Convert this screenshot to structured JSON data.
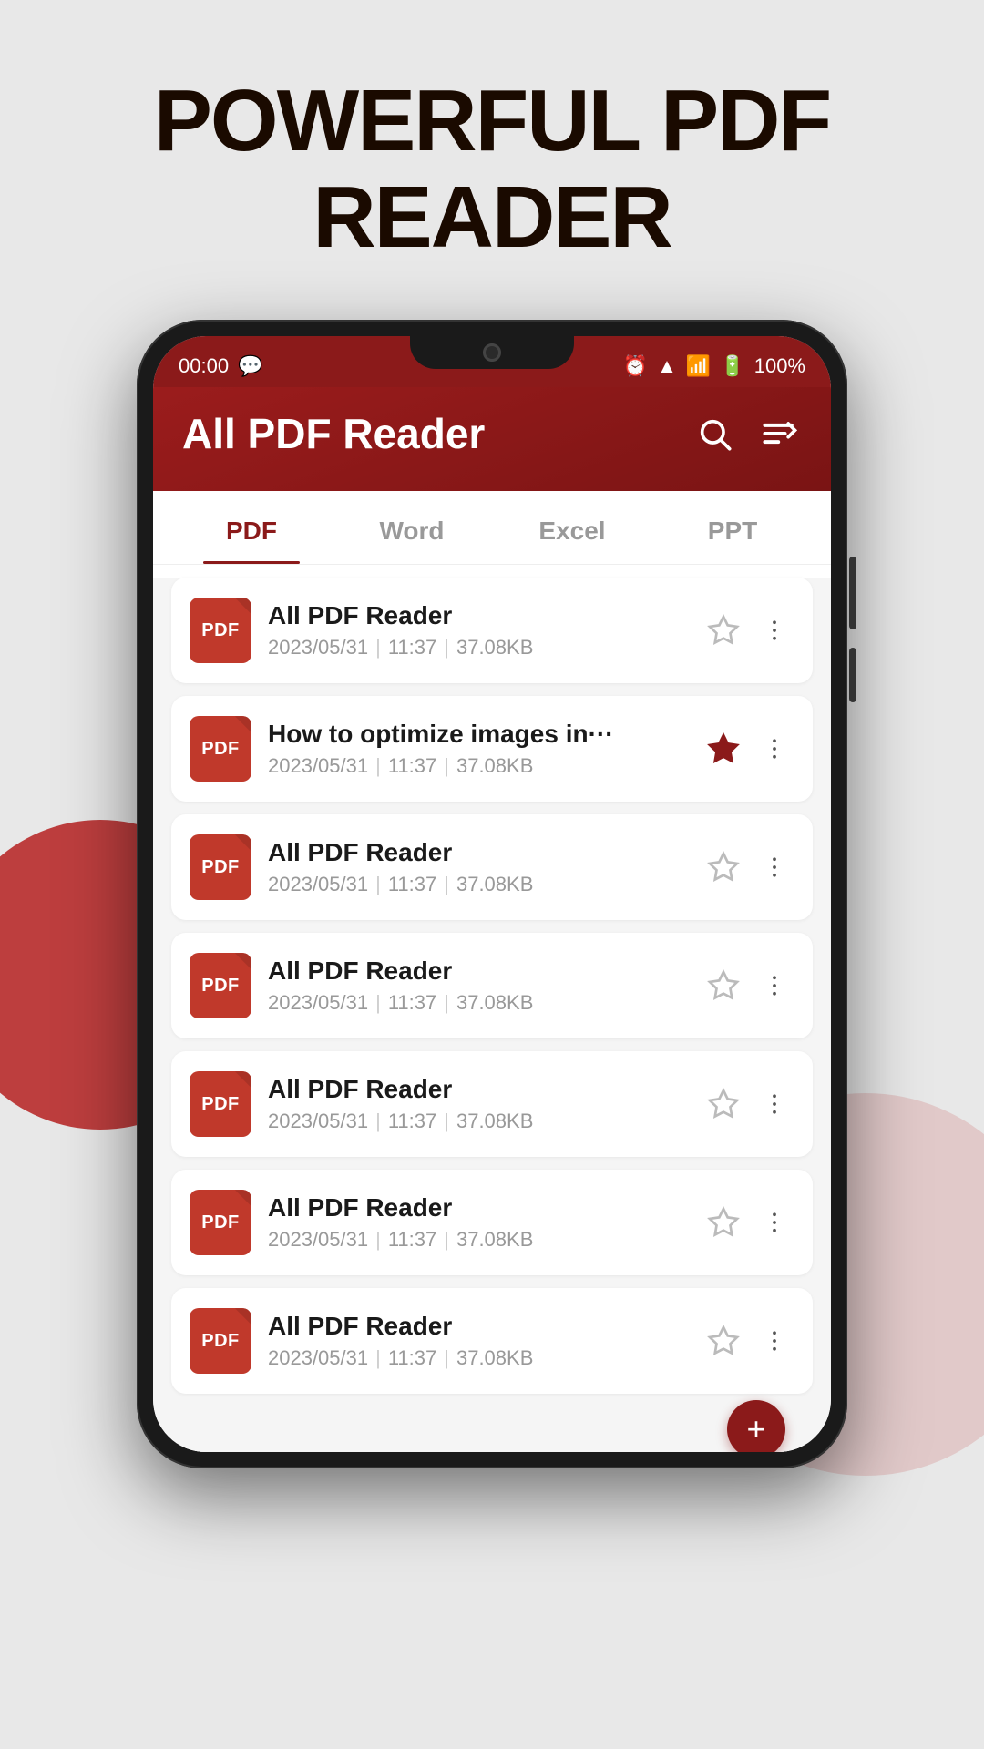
{
  "page": {
    "headline_line1": "POWERFUL PDF",
    "headline_line2": "READER"
  },
  "statusbar": {
    "time": "00:00",
    "battery": "100%"
  },
  "header": {
    "title": "All PDF Reader"
  },
  "tabs": [
    {
      "id": "pdf",
      "label": "PDF",
      "active": true
    },
    {
      "id": "word",
      "label": "Word",
      "active": false
    },
    {
      "id": "excel",
      "label": "Excel",
      "active": false
    },
    {
      "id": "ppt",
      "label": "PPT",
      "active": false
    }
  ],
  "files": [
    {
      "name": "All PDF Reader",
      "date": "2023/05/31",
      "time": "11:37",
      "size": "37.08KB",
      "starred": false,
      "icon_type": "PDF"
    },
    {
      "name": "How to optimize images in···",
      "date": "2023/05/31",
      "time": "11:37",
      "size": "37.08KB",
      "starred": true,
      "icon_type": "PDF"
    },
    {
      "name": "All PDF Reader",
      "date": "2023/05/31",
      "time": "11:37",
      "size": "37.08KB",
      "starred": false,
      "icon_type": "PDF"
    },
    {
      "name": "All PDF Reader",
      "date": "2023/05/31",
      "time": "11:37",
      "size": "37.08KB",
      "starred": false,
      "icon_type": "PDF"
    },
    {
      "name": "All PDF Reader",
      "date": "2023/05/31",
      "time": "11:37",
      "size": "37.08KB",
      "starred": false,
      "icon_type": "PDF"
    },
    {
      "name": "All PDF Reader",
      "date": "2023/05/31",
      "time": "11:37",
      "size": "37.08KB",
      "starred": false,
      "icon_type": "PDF"
    },
    {
      "name": "All PDF Reader",
      "date": "2023/05/31",
      "time": "11:37",
      "size": "37.08KB",
      "starred": false,
      "icon_type": "PDF"
    }
  ],
  "colors": {
    "brand_red": "#8b1a1a",
    "dark_red": "#7a1414",
    "text_dark": "#1a0a00"
  }
}
